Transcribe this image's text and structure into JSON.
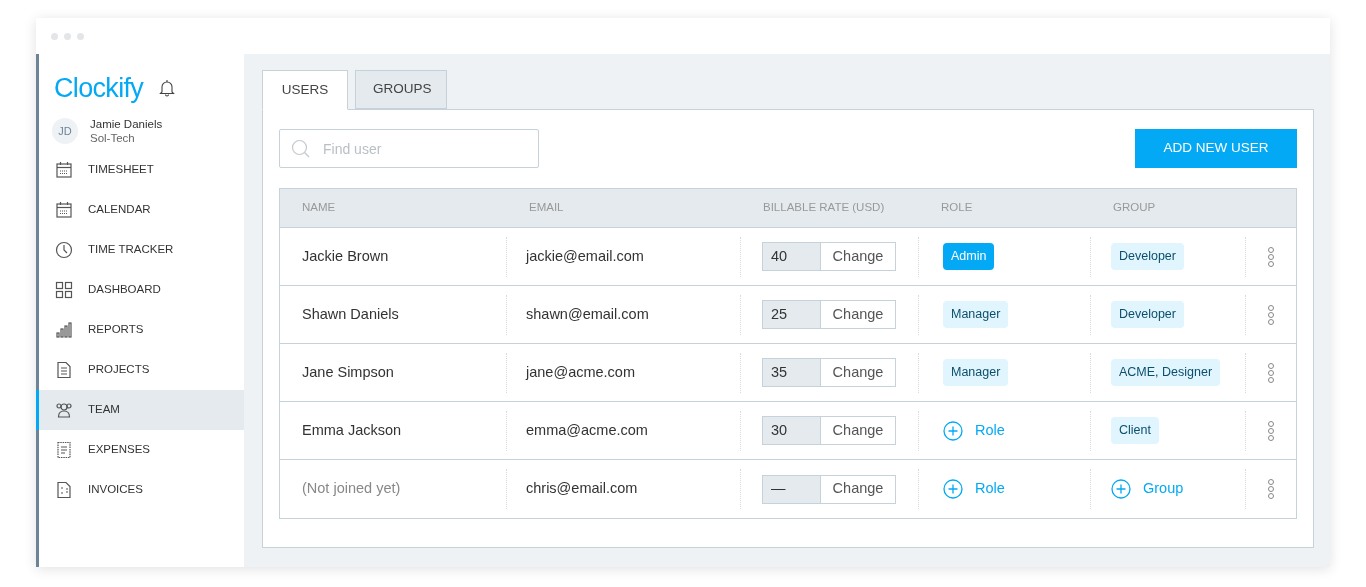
{
  "brand": {
    "name": "Clockify"
  },
  "user": {
    "initials": "JD",
    "name": "Jamie Daniels",
    "company": "Sol-Tech"
  },
  "sidebar": {
    "items": [
      {
        "kind": "timesheet",
        "label": "TIMESHEET",
        "selected": false
      },
      {
        "kind": "calendar",
        "label": "CALENDAR",
        "selected": false
      },
      {
        "kind": "clock",
        "label": "TIME TRACKER",
        "selected": false
      },
      {
        "kind": "dashboard",
        "label": "DASHBOARD",
        "selected": false
      },
      {
        "kind": "reports",
        "label": "REPORTS",
        "selected": false
      },
      {
        "kind": "document",
        "label": "PROJECTS",
        "selected": false
      },
      {
        "kind": "team",
        "label": "TEAM",
        "selected": true
      },
      {
        "kind": "receipt",
        "label": "EXPENSES",
        "selected": false
      },
      {
        "kind": "invoice",
        "label": "INVOICES",
        "selected": false
      }
    ]
  },
  "tabs": [
    {
      "label": "USERS",
      "selected": true
    },
    {
      "label": "GROUPS",
      "selected": false
    }
  ],
  "search": {
    "placeholder": "Find user"
  },
  "add_button": "ADD NEW USER",
  "table": {
    "columns": [
      "NAME",
      "EMAIL",
      "BILLABLE RATE (USD)",
      "ROLE",
      "GROUP"
    ],
    "rows": [
      {
        "name": "Jackie Brown",
        "joined": true,
        "email": "jackie@email.com",
        "rate": "40",
        "change": "Change",
        "role": {
          "kind": "tag",
          "label": "Admin",
          "filled": true
        },
        "group": {
          "kind": "tag",
          "label": "Developer"
        }
      },
      {
        "name": "Shawn Daniels",
        "joined": true,
        "email": "shawn@email.com",
        "rate": "25",
        "change": "Change",
        "role": {
          "kind": "tag",
          "label": "Manager",
          "filled": false
        },
        "group": {
          "kind": "tag",
          "label": "Developer"
        }
      },
      {
        "name": "Jane Simpson",
        "joined": true,
        "email": "jane@acme.com",
        "rate": "35",
        "change": "Change",
        "role": {
          "kind": "tag",
          "label": "Manager",
          "filled": false
        },
        "group": {
          "kind": "tag",
          "label": "ACME, Designer"
        }
      },
      {
        "name": "Emma Jackson",
        "joined": true,
        "email": "emma@acme.com",
        "rate": "30",
        "change": "Change",
        "role": {
          "kind": "add",
          "label": "Role"
        },
        "group": {
          "kind": "tag",
          "label": "Client"
        }
      },
      {
        "name": "(Not joined yet)",
        "joined": false,
        "email": "chris@email.com",
        "rate": "—",
        "change": "Change",
        "role": {
          "kind": "add",
          "label": "Role"
        },
        "group": {
          "kind": "add",
          "label": "Group"
        }
      }
    ]
  }
}
